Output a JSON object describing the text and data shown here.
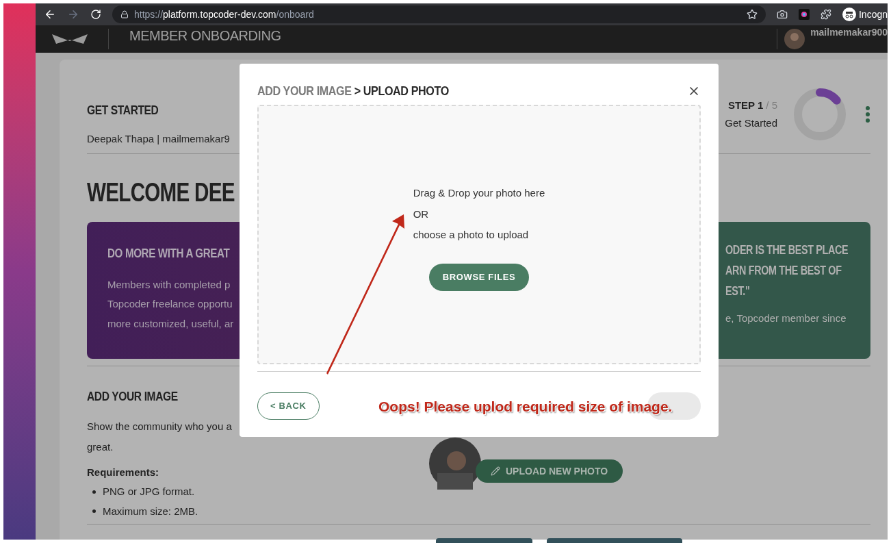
{
  "browser": {
    "url_parts": [
      {
        "text": "https://",
        "emphasis": false
      },
      {
        "text": "platform.topcoder-dev.com",
        "emphasis": true
      },
      {
        "text": "/onboard",
        "emphasis": false
      }
    ],
    "profile_label": "Incogn"
  },
  "header": {
    "title": "MEMBER ONBOARDING",
    "username": "mailmemakar900"
  },
  "step": {
    "title": "GET STARTED",
    "user_line": "Deepak Thapa | mailmemakar9",
    "step_label": "STEP 1",
    "step_total": "/ 5",
    "step_name": "Get Started",
    "level": 0.14
  },
  "welcome": "WELCOME DEE",
  "promo_card": {
    "title": "DO MORE WITH A GREAT",
    "lines": [
      "Members with completed p",
      "Topcoder freelance opportu",
      "more customized, useful, ar"
    ]
  },
  "quote_card": {
    "lines": [
      "ODER IS THE BEST PLACE",
      "ARN FROM THE BEST OF",
      "EST.\""
    ],
    "author": "e, Topcoder member since"
  },
  "image_section": {
    "title": "ADD YOUR IMAGE",
    "description_lines": [
      "Show the community who you a",
      "great."
    ],
    "requirements_title": "Requirements:",
    "requirements": [
      "PNG or JPG format.",
      "Maximum size: 2MB."
    ],
    "upload_button": "UPLOAD NEW PHOTO"
  },
  "modal": {
    "breadcrumb": "ADD YOUR IMAGE",
    "title": "> UPLOAD PHOTO",
    "drop_lines": [
      "Drag & Drop your photo here",
      "OR",
      "choose a photo to upload"
    ],
    "browse_button": "BROWSE FILES",
    "back_button": "< BACK"
  },
  "annotation": {
    "text": "Oops! Please uplod required size of image."
  }
}
